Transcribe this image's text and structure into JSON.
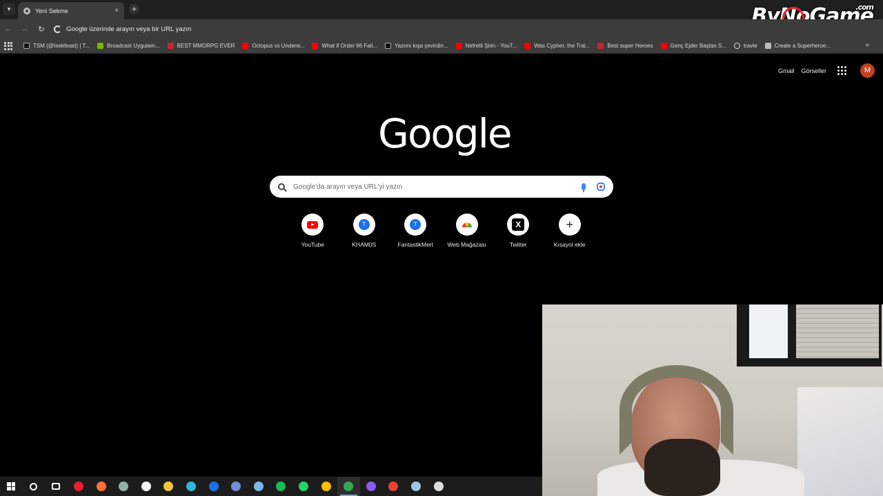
{
  "tab": {
    "title": "Yeni Sekme",
    "close_glyph": "×",
    "new_glyph": "+"
  },
  "watermark": {
    "text_a": "By",
    "text_no": "No",
    "text_b": "Game",
    "suffix": ".com"
  },
  "omnibox": {
    "text": "Google üzerinde arayın veya bir URL yazın"
  },
  "bookmarks": [
    {
      "label": "TSM (@teekfeast) | T...",
      "icon": "tiktok-icon"
    },
    {
      "label": "Broadcast Uygulam...",
      "icon": "nvidia-icon"
    },
    {
      "label": "BEST MMORPG EVER",
      "icon": "udemy-icon"
    },
    {
      "label": "Octopus vs Underw...",
      "icon": "youtube-icon"
    },
    {
      "label": "What if Order 66 Fail...",
      "icon": "youtube-icon"
    },
    {
      "label": "Yazımı kışa çevirdin...",
      "icon": "tiktok-icon"
    },
    {
      "label": "Nefretli Şirin - YouT...",
      "icon": "youtube-icon"
    },
    {
      "label": "Was Cypher, the Trai...",
      "icon": "youtube-icon"
    },
    {
      "label": "Best super Heroes",
      "icon": "udemy-icon"
    },
    {
      "label": "Genç Ejder Baştan S...",
      "icon": "youtube-icon"
    },
    {
      "label": "travle",
      "icon": "compass-icon"
    },
    {
      "label": "Create a Superheroe...",
      "icon": "document-icon"
    }
  ],
  "top_links": {
    "gmail": "Gmail",
    "images": "Görseller",
    "avatar_letter": "M"
  },
  "logo": "Google",
  "search": {
    "placeholder": "Google'da arayın veya URL'yi yazın"
  },
  "shortcuts": [
    {
      "label": "YouTube",
      "icon": "youtube-icon"
    },
    {
      "label": "KHAM0S",
      "icon": "letter-t-icon",
      "glyph": "T"
    },
    {
      "label": "FantastikMert",
      "icon": "letter-t-icon",
      "glyph": "T"
    },
    {
      "label": "Web Mağazası",
      "icon": "rainbow-icon"
    },
    {
      "label": "Twitter",
      "icon": "x-icon",
      "glyph": "X"
    },
    {
      "label": "Kısayol ekle",
      "icon": "plus-icon",
      "glyph": "+"
    }
  ],
  "taskbar": [
    {
      "icon": "windows-start-icon",
      "color": "#ffffff"
    },
    {
      "icon": "search-icon",
      "color": "#ffffff"
    },
    {
      "icon": "task-view-icon",
      "color": "#ffffff"
    },
    {
      "icon": "opera-icon",
      "color": "#e8212f"
    },
    {
      "icon": "firefox-icon",
      "color": "#ff7139"
    },
    {
      "icon": "app-icon",
      "color": "#8fb3a8"
    },
    {
      "icon": "store-icon",
      "color": "#f3f3f3"
    },
    {
      "icon": "file-explorer-icon",
      "color": "#f5c542"
    },
    {
      "icon": "edge-icon",
      "color": "#2eb7d9"
    },
    {
      "icon": "outlook-icon",
      "color": "#1a73e8"
    },
    {
      "icon": "app-icon",
      "color": "#6f8fd6"
    },
    {
      "icon": "app-icon",
      "color": "#7fb6e6"
    },
    {
      "icon": "spotify-icon",
      "color": "#1db954"
    },
    {
      "icon": "whatsapp-icon",
      "color": "#25d366"
    },
    {
      "icon": "chrome-icon",
      "color": "#fbbc04"
    },
    {
      "icon": "chrome-icon",
      "color": "#34a853",
      "active": true
    },
    {
      "icon": "discord-icon",
      "color": "#8a5cf6"
    },
    {
      "icon": "chrome-icon",
      "color": "#ea4335"
    },
    {
      "icon": "steam-icon",
      "color": "#9ec3e6"
    },
    {
      "icon": "app-icon",
      "color": "#dddddd"
    }
  ]
}
